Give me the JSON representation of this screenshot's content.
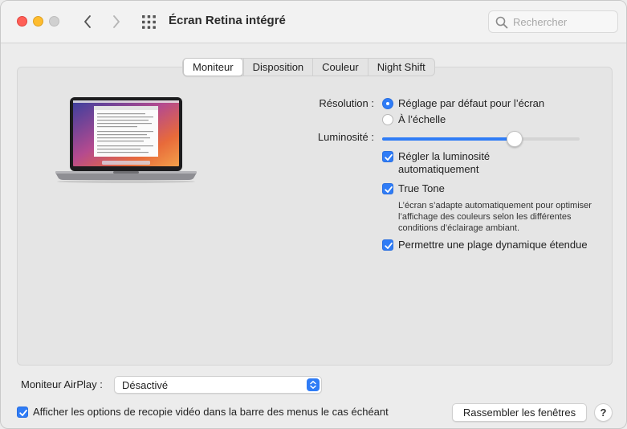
{
  "window": {
    "title": "Écran Retina intégré"
  },
  "toolbar": {
    "back_icon": "chevron-left-icon",
    "forward_icon": "chevron-right-icon",
    "grid_icon": "grid-icon"
  },
  "search": {
    "placeholder": "Rechercher",
    "icon": "search-icon"
  },
  "tabs": [
    {
      "label": "Moniteur",
      "active": true
    },
    {
      "label": "Disposition",
      "active": false
    },
    {
      "label": "Couleur",
      "active": false
    },
    {
      "label": "Night Shift",
      "active": false
    }
  ],
  "display": {
    "resolution_label": "Résolution :",
    "resolution_options": [
      {
        "label": "Réglage par défaut pour l’écran",
        "selected": true
      },
      {
        "label": "À l’échelle",
        "selected": false
      }
    ],
    "brightness_label": "Luminosité :",
    "brightness_level": 0.67,
    "auto_brightness_label_line1": "Régler la luminosité",
    "auto_brightness_label_line2": "automatiquement",
    "auto_brightness_checked": true,
    "true_tone_label": "True Tone",
    "true_tone_checked": true,
    "true_tone_description": "L’écran s’adapte automatiquement pour optimiser l’affichage des couleurs selon les différentes conditions d’éclairage ambiant.",
    "hdr_label": "Permettre une plage dynamique étendue",
    "hdr_checked": true
  },
  "footer": {
    "airplay_label": "Moniteur AirPlay :",
    "airplay_value": "Désactivé",
    "mirror_label": "Afficher les options de recopie vidéo dans la barre des menus le cas échéant",
    "mirror_checked": true,
    "gather_button": "Rassembler les fenêtres",
    "help_label": "?"
  },
  "colors": {
    "accent": "#2f7cf6",
    "close": "#ff5f57",
    "minimize": "#febc2e",
    "zoom_disabled": "#d0d0d0"
  }
}
